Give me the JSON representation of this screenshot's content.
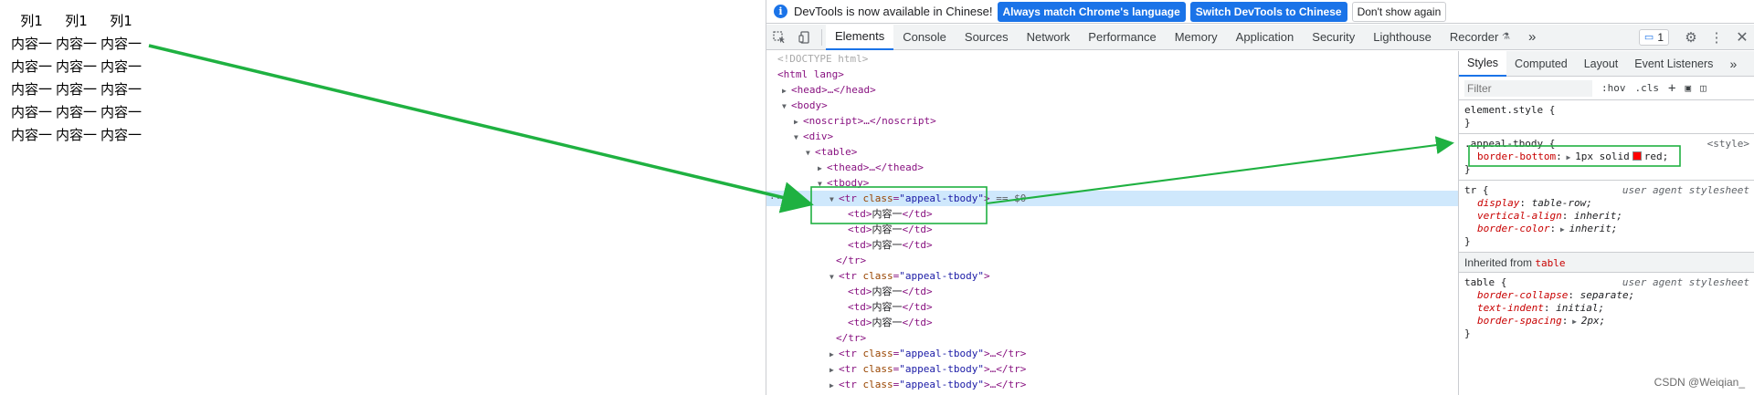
{
  "page": {
    "table_headers": [
      "列1",
      "列1",
      "列1"
    ],
    "table_rows": [
      [
        "内容一",
        "内容一",
        "内容一"
      ],
      [
        "内容一",
        "内容一",
        "内容一"
      ],
      [
        "内容一",
        "内容一",
        "内容一"
      ],
      [
        "内容一",
        "内容一",
        "内容一"
      ],
      [
        "内容一",
        "内容一",
        "内容一"
      ]
    ]
  },
  "infobar": {
    "message": "DevTools is now available in Chinese!",
    "btn_match": "Always match Chrome's language",
    "btn_switch": "Switch DevTools to Chinese",
    "btn_dismiss": "Don't show again"
  },
  "tabs": [
    "Elements",
    "Console",
    "Sources",
    "Network",
    "Performance",
    "Memory",
    "Application",
    "Security",
    "Lighthouse",
    "Recorder"
  ],
  "more_tabs_glyph": "»",
  "issues_count": "1",
  "dom": {
    "doctype": "<!DOCTYPE html>",
    "html_open": "<html lang>",
    "head": "<head>…</head>",
    "body": "<body>",
    "noscript": "<noscript>…</noscript>",
    "div": "<div>",
    "table": "<table>",
    "thead": "<thead>…</thead>",
    "tbody": "<tbody>",
    "tr_tag": "tr",
    "class_attr": "class",
    "class_val": "\"appeal-tbody\"",
    "selected_marker": "== $0",
    "td_text": "内容一",
    "tr_close": "</tr>",
    "collapsed_tr_close": "…</tr>"
  },
  "styles": {
    "tabs": [
      "Styles",
      "Computed",
      "Layout",
      "Event Listeners"
    ],
    "filter_placeholder": "Filter",
    "hov": ":hov",
    "cls": ".cls",
    "element_style": "element.style {",
    "close_brace": "}",
    "rule1_selector": ".appeal-tbody {",
    "rule1_source": "<style>",
    "rule1_prop": "border-bottom",
    "rule1_val_a": "1px solid",
    "rule1_val_b": "red;",
    "rule2_selector": "tr {",
    "ua_source": "user agent stylesheet",
    "rule2_props": [
      {
        "name": "display",
        "value": "table-row;"
      },
      {
        "name": "vertical-align",
        "value": "inherit;"
      },
      {
        "name": "border-color",
        "value": "inherit;"
      }
    ],
    "inherited_label": "Inherited from",
    "inherited_from": "table",
    "rule3_selector": "table {",
    "rule3_props": [
      {
        "name": "border-collapse",
        "value": "separate;"
      },
      {
        "name": "text-indent",
        "value": "initial;"
      },
      {
        "name": "border-spacing",
        "value": "2px;"
      }
    ]
  },
  "watermark": "CSDN @Weiqian_",
  "colors": {
    "accent": "#1a73e8",
    "annotation_green": "#1fb141",
    "swatch_red": "#ff0000"
  }
}
